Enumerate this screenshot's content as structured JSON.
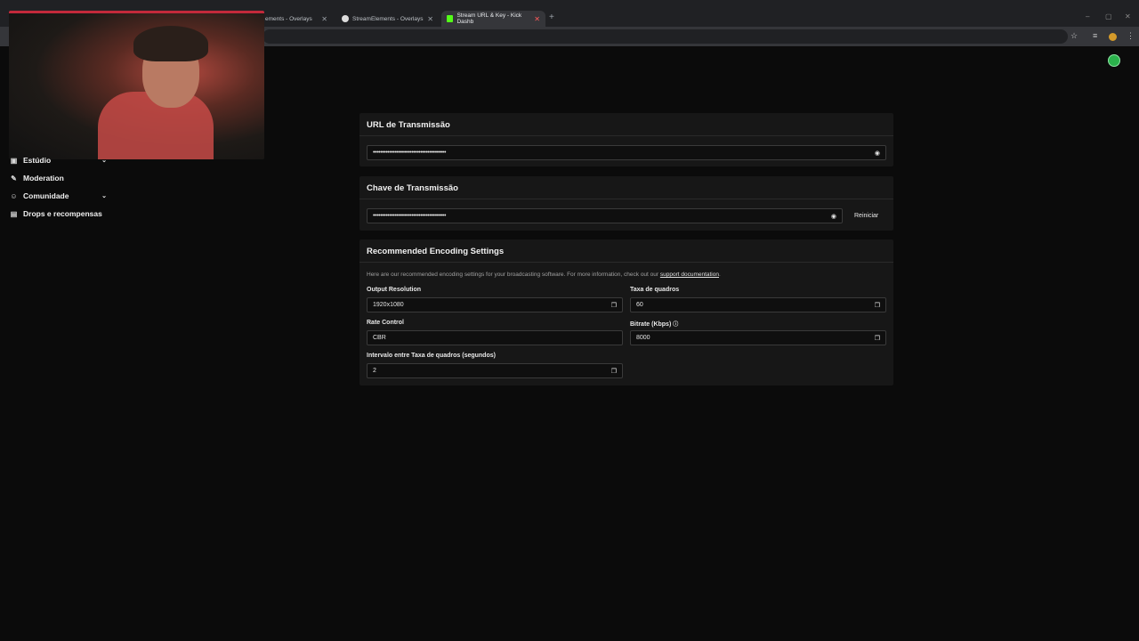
{
  "browser": {
    "tabs": [
      {
        "label": "ements - Overlays",
        "active": false
      },
      {
        "label": "StreamElements - Overlays",
        "active": false
      },
      {
        "label": "Stream URL & Key - Kick Dashb",
        "active": true
      }
    ],
    "new_tab": "+",
    "window_controls": [
      "–",
      "▢",
      "✕"
    ]
  },
  "sidebar": {
    "items": [
      {
        "label": "Estúdio",
        "icon": "studio-icon",
        "expandable": true
      },
      {
        "label": "Moderation",
        "icon": "wrench-icon",
        "expandable": false
      },
      {
        "label": "Comunidade",
        "icon": "users-icon",
        "expandable": true
      },
      {
        "label": "Drops e recompensas",
        "icon": "gift-icon",
        "expandable": false
      }
    ]
  },
  "stream_url": {
    "title": "URL de Transmissão",
    "value": "••••••••••••••••••••••••••••••••••••••••"
  },
  "stream_key": {
    "title": "Chave de Transmissão",
    "value": "••••••••••••••••••••••••••••••••••••••••",
    "reset_label": "Reiniciar"
  },
  "encoding": {
    "title": "Recommended Encoding Settings",
    "description": "Here are our recommended encoding settings for your broadcasting software. For more information, check out our ",
    "link_text": "support documentation",
    "description_end": ".",
    "fields": {
      "output_resolution": {
        "label": "Output Resolution",
        "value": "1920x1080"
      },
      "frame_rate": {
        "label": "Taxa de quadros",
        "value": "60"
      },
      "rate_control": {
        "label": "Rate Control",
        "value": "CBR"
      },
      "bitrate": {
        "label": "Bitrate (Kbps)",
        "value": "8000"
      },
      "keyframe_interval": {
        "label": "Intervalo entre Taxa de quadros (segundos)",
        "value": "2"
      }
    }
  },
  "colors": {
    "accent_green": "#53fc18",
    "active_tab_close": "#e03131"
  }
}
